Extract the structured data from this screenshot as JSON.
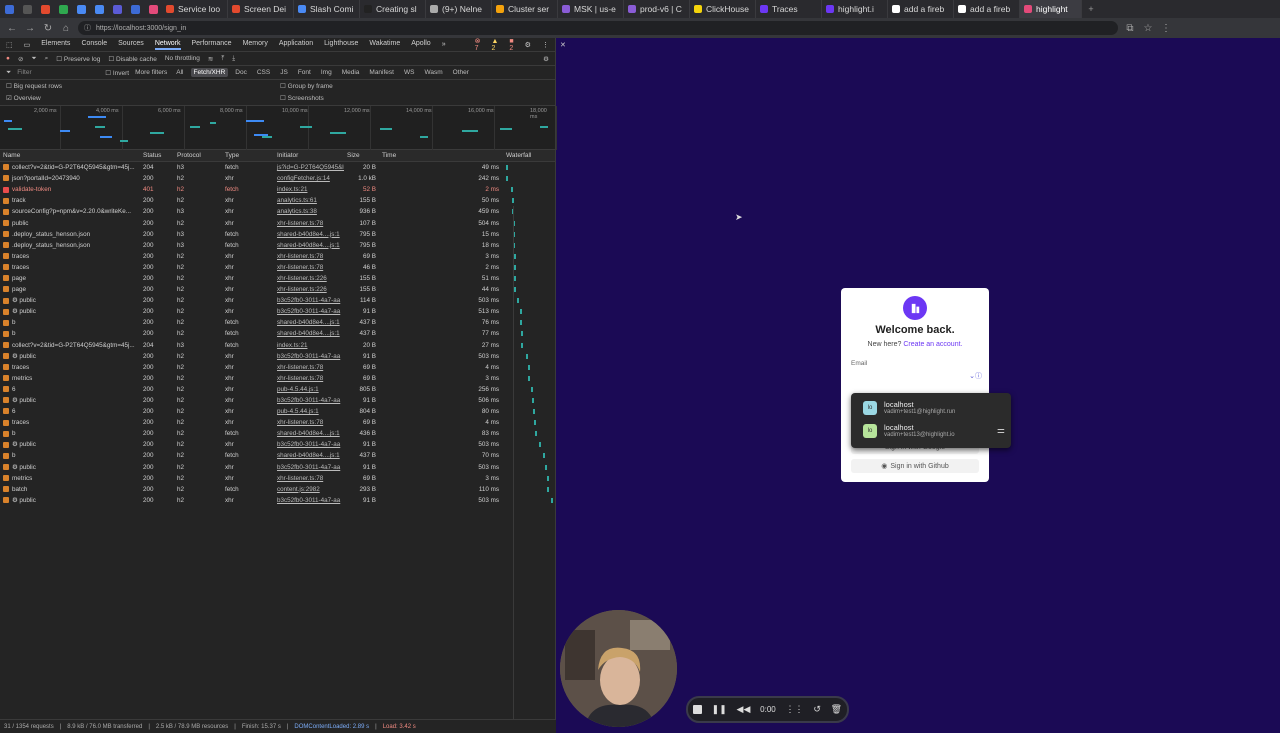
{
  "tabs": [
    {
      "label": "Service loo",
      "color": "#e34a2e"
    },
    {
      "label": "Screen Dei",
      "color": "#e34a2e"
    },
    {
      "label": "Slash Comi",
      "color": "#4a8af4"
    },
    {
      "label": "Creating sl",
      "color": "#222222"
    },
    {
      "label": "(9+) Nelne",
      "color": "#aaaaaa"
    },
    {
      "label": "Cluster ser",
      "color": "#f4a20c"
    },
    {
      "label": "MSK | us-e",
      "color": "#8a5cd6"
    },
    {
      "label": "prod-v6 | C",
      "color": "#8a5cd6"
    },
    {
      "label": "ClickHouse",
      "color": "#f4d40c"
    },
    {
      "label": "Traces",
      "color": "#6c37f4"
    },
    {
      "label": "highlight.i",
      "color": "#6c37f4"
    },
    {
      "label": "add a fireb",
      "color": "#ffffff"
    },
    {
      "label": "add a fireb",
      "color": "#ffffff"
    },
    {
      "label": "highlight",
      "color": "#e34a7a"
    }
  ],
  "url": "https://localhost:3000/sign_in",
  "devtools": {
    "tabs": [
      "Elements",
      "Console",
      "Sources",
      "Network",
      "Performance",
      "Memory",
      "Application",
      "Lighthouse",
      "Wakatime",
      "Apollo"
    ],
    "active_tab": "Network",
    "badges": {
      "errors": "7",
      "warnings": "2",
      "info": "2"
    },
    "preserve_log": "Preserve log",
    "disable_cache": "Disable cache",
    "throttling": "No throttling",
    "filter_placeholder": "Filter",
    "invert": "Invert",
    "more_filters": "More filters",
    "type_filters": [
      "All",
      "Fetch/XHR",
      "Doc",
      "CSS",
      "JS",
      "Font",
      "Img",
      "Media",
      "Manifest",
      "WS",
      "Wasm",
      "Other"
    ],
    "active_filter": "Fetch/XHR",
    "big_rows": "Big request rows",
    "overview": "Overview",
    "group_by_frame": "Group by frame",
    "screenshots": "Screenshots",
    "ticks": [
      "2,000 ms",
      "4,000 ms",
      "6,000 ms",
      "8,000 ms",
      "10,000 ms",
      "12,000 ms",
      "14,000 ms",
      "16,000 ms",
      "18,000 ms"
    ],
    "columns": {
      "name": "Name",
      "status": "Status",
      "protocol": "Protocol",
      "type": "Type",
      "initiator": "Initiator",
      "size": "Size",
      "time": "Time",
      "waterfall": "Waterfall"
    },
    "rows": [
      {
        "name": "collect?v=2&tid=G-P2T64Q5945&gtm=45j...",
        "status": "204",
        "protocol": "h3",
        "type": "fetch",
        "initiator": "js?id=G-P2T64Q5945&l=",
        "size": "20 B",
        "time": "49 ms",
        "kind": "fetch",
        "wf": 3
      },
      {
        "name": "json?portalId=20473940",
        "status": "200",
        "protocol": "h2",
        "type": "xhr",
        "initiator": "configFetcher.js:14",
        "size": "1.0 kB",
        "time": "242 ms",
        "kind": "xhr",
        "wf": 3
      },
      {
        "name": "validate-token",
        "status": "401",
        "protocol": "h2",
        "type": "fetch",
        "initiator": "index.ts:21",
        "size": "52 B",
        "time": "2 ms",
        "kind": "error",
        "wf": 8
      },
      {
        "name": "track",
        "status": "200",
        "protocol": "h2",
        "type": "xhr",
        "initiator": "analytics.ts:61",
        "size": "155 B",
        "time": "50 ms",
        "kind": "xhr",
        "wf": 9
      },
      {
        "name": "sourceConfig?p=npm&v=2.20.0&writeKe...",
        "status": "200",
        "protocol": "h3",
        "type": "xhr",
        "initiator": "analytics.ts:38",
        "size": "936 B",
        "time": "459 ms",
        "kind": "xhr",
        "wf": 9
      },
      {
        "name": "public",
        "status": "200",
        "protocol": "h2",
        "type": "xhr",
        "initiator": "xhr-listener.ts:78",
        "size": "107 B",
        "time": "504 ms",
        "kind": "xhr",
        "wf": 10
      },
      {
        "name": ".deploy_status_henson.json",
        "status": "200",
        "protocol": "h3",
        "type": "fetch",
        "initiator": "shared-b40d8e4....js:1",
        "size": "795 B",
        "time": "15 ms",
        "kind": "fetch",
        "wf": 10
      },
      {
        "name": ".deploy_status_henson.json",
        "status": "200",
        "protocol": "h3",
        "type": "fetch",
        "initiator": "shared-b40d8e4....js:1",
        "size": "795 B",
        "time": "18 ms",
        "kind": "fetch",
        "wf": 10
      },
      {
        "name": "traces",
        "status": "200",
        "protocol": "h2",
        "type": "xhr",
        "initiator": "xhr-listener.ts:78",
        "size": "69 B",
        "time": "3 ms",
        "kind": "xhr",
        "wf": 11
      },
      {
        "name": "traces",
        "status": "200",
        "protocol": "h2",
        "type": "xhr",
        "initiator": "xhr-listener.ts:78",
        "size": "46 B",
        "time": "2 ms",
        "kind": "xhr",
        "wf": 11
      },
      {
        "name": "page",
        "status": "200",
        "protocol": "h2",
        "type": "xhr",
        "initiator": "xhr-listener.ts:226",
        "size": "155 B",
        "time": "51 ms",
        "kind": "xhr",
        "wf": 11
      },
      {
        "name": "page",
        "status": "200",
        "protocol": "h2",
        "type": "xhr",
        "initiator": "xhr-listener.ts:226",
        "size": "155 B",
        "time": "44 ms",
        "kind": "xhr",
        "wf": 11
      },
      {
        "name": "⚙ public",
        "status": "200",
        "protocol": "h2",
        "type": "xhr",
        "initiator": "b3c52fb0-3011-4a7-aa",
        "size": "114 B",
        "time": "503 ms",
        "kind": "xhr",
        "wf": 13
      },
      {
        "name": "⚙ public",
        "status": "200",
        "protocol": "h2",
        "type": "xhr",
        "initiator": "b3c52fb0-3011-4a7-aa",
        "size": "91 B",
        "time": "513 ms",
        "kind": "xhr",
        "wf": 16
      },
      {
        "name": "b",
        "status": "200",
        "protocol": "h2",
        "type": "fetch",
        "initiator": "shared-b40d8e4....js:1",
        "size": "437 B",
        "time": "76 ms",
        "kind": "fetch",
        "wf": 16
      },
      {
        "name": "b",
        "status": "200",
        "protocol": "h2",
        "type": "fetch",
        "initiator": "shared-b40d8e4....js:1",
        "size": "437 B",
        "time": "77 ms",
        "kind": "fetch",
        "wf": 17
      },
      {
        "name": "collect?v=2&tid=G-P2T64Q5945&gtm=45j...",
        "status": "204",
        "protocol": "h3",
        "type": "fetch",
        "initiator": "index.ts:21",
        "size": "20 B",
        "time": "27 ms",
        "kind": "fetch",
        "wf": 17
      },
      {
        "name": "⚙ public",
        "status": "200",
        "protocol": "h2",
        "type": "xhr",
        "initiator": "b3c52fb0-3011-4a7-aa",
        "size": "91 B",
        "time": "503 ms",
        "kind": "xhr",
        "wf": 22
      },
      {
        "name": "traces",
        "status": "200",
        "protocol": "h2",
        "type": "xhr",
        "initiator": "xhr-listener.ts:78",
        "size": "69 B",
        "time": "4 ms",
        "kind": "xhr",
        "wf": 24
      },
      {
        "name": "metrics",
        "status": "200",
        "protocol": "h2",
        "type": "xhr",
        "initiator": "xhr-listener.ts:78",
        "size": "69 B",
        "time": "3 ms",
        "kind": "xhr",
        "wf": 24
      },
      {
        "name": "6",
        "status": "200",
        "protocol": "h2",
        "type": "xhr",
        "initiator": "pub-4.5.44.js:1",
        "size": "805 B",
        "time": "256 ms",
        "kind": "xhr",
        "wf": 27
      },
      {
        "name": "⚙ public",
        "status": "200",
        "protocol": "h2",
        "type": "xhr",
        "initiator": "b3c52fb0-3011-4a7-aa",
        "size": "91 B",
        "time": "506 ms",
        "kind": "xhr",
        "wf": 28
      },
      {
        "name": "6",
        "status": "200",
        "protocol": "h2",
        "type": "xhr",
        "initiator": "pub-4.5.44.js:1",
        "size": "804 B",
        "time": "80 ms",
        "kind": "xhr",
        "wf": 29
      },
      {
        "name": "traces",
        "status": "200",
        "protocol": "h2",
        "type": "xhr",
        "initiator": "xhr-listener.ts:78",
        "size": "69 B",
        "time": "4 ms",
        "kind": "xhr",
        "wf": 30
      },
      {
        "name": "b",
        "status": "200",
        "protocol": "h2",
        "type": "fetch",
        "initiator": "shared-b40d8e4....js:1",
        "size": "436 B",
        "time": "83 ms",
        "kind": "fetch",
        "wf": 31
      },
      {
        "name": "⚙ public",
        "status": "200",
        "protocol": "h2",
        "type": "xhr",
        "initiator": "b3c52fb0-3011-4a7-aa",
        "size": "91 B",
        "time": "503 ms",
        "kind": "xhr",
        "wf": 35
      },
      {
        "name": "b",
        "status": "200",
        "protocol": "h2",
        "type": "fetch",
        "initiator": "shared-b40d8e4....js:1",
        "size": "437 B",
        "time": "70 ms",
        "kind": "fetch",
        "wf": 38
      },
      {
        "name": "⚙ public",
        "status": "200",
        "protocol": "h2",
        "type": "xhr",
        "initiator": "b3c52fb0-3011-4a7-aa",
        "size": "91 B",
        "time": "503 ms",
        "kind": "xhr",
        "wf": 40
      },
      {
        "name": "metrics",
        "status": "200",
        "protocol": "h2",
        "type": "xhr",
        "initiator": "xhr-listener.ts:78",
        "size": "69 B",
        "time": "3 ms",
        "kind": "xhr",
        "wf": 42
      },
      {
        "name": "batch",
        "status": "200",
        "protocol": "h2",
        "type": "fetch",
        "initiator": "content.js:2982",
        "size": "293 B",
        "time": "110 ms",
        "kind": "fetch",
        "wf": 42
      },
      {
        "name": "⚙ public",
        "status": "200",
        "protocol": "h2",
        "type": "xhr",
        "initiator": "b3c52fb0-3011-4a7-aa",
        "size": "91 B",
        "time": "503 ms",
        "kind": "xhr",
        "wf": 46
      }
    ],
    "summary": {
      "requests": "31 / 1354 requests",
      "transferred": "8.9 kB / 76.0 MB transferred",
      "resources": "2.5 kB / 78.9 MB resources",
      "finish": "Finish: 15.37 s",
      "dcl": "DOMContentLoaded: 2.89 s",
      "load": "Load: 3.42 s"
    }
  },
  "login": {
    "title": "Welcome back.",
    "new_here": "New here?",
    "create_account": "Create an account.",
    "email_label": "Email",
    "google": "Sign in with Google",
    "github": "Sign in with Github"
  },
  "autofill": [
    {
      "host": "localhost",
      "user": "vadim+test1@highlight.run",
      "color": "#9ad7e3"
    },
    {
      "host": "localhost",
      "user": "vadim+test13@highlight.io",
      "color": "#b6e39a"
    }
  ],
  "recorder": {
    "time": "0:00"
  }
}
